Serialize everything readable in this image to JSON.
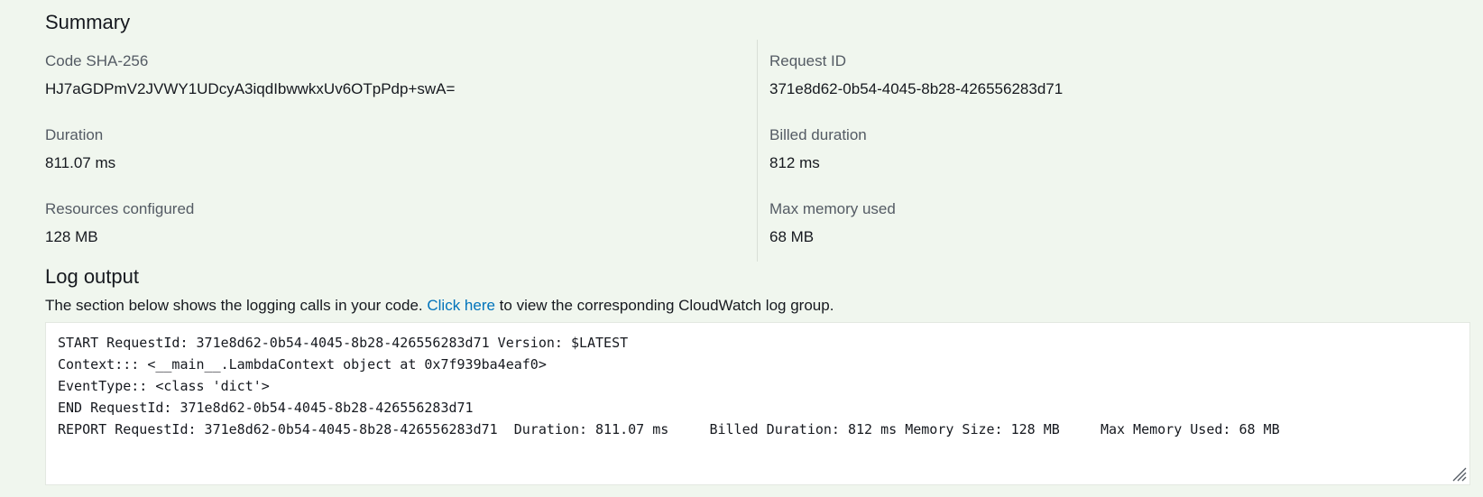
{
  "summary": {
    "title": "Summary",
    "left": [
      {
        "label": "Code SHA-256",
        "value": "HJ7aGDPmV2JVWY1UDcyA3iqdIbwwkxUv6OTpPdp+swA="
      },
      {
        "label": "Duration",
        "value": "811.07 ms"
      },
      {
        "label": "Resources configured",
        "value": "128 MB"
      }
    ],
    "right": [
      {
        "label": "Request ID",
        "value": "371e8d62-0b54-4045-8b28-426556283d71"
      },
      {
        "label": "Billed duration",
        "value": "812 ms"
      },
      {
        "label": "Max memory used",
        "value": "68 MB"
      }
    ]
  },
  "log_output": {
    "title": "Log output",
    "description_before": "The section below shows the logging calls in your code. ",
    "link_text": "Click here",
    "description_after": " to view the corresponding CloudWatch log group.",
    "lines": [
      "START RequestId: 371e8d62-0b54-4045-8b28-426556283d71 Version: $LATEST",
      "Context::: <__main__.LambdaContext object at 0x7f939ba4eaf0>",
      "EventType:: <class 'dict'>",
      "END RequestId: 371e8d62-0b54-4045-8b28-426556283d71",
      "REPORT RequestId: 371e8d62-0b54-4045-8b28-426556283d71  Duration: 811.07 ms     Billed Duration: 812 ms Memory Size: 128 MB     Max Memory Used: 68 MB"
    ]
  },
  "icons": {
    "resize": "resize-handle-icon"
  }
}
